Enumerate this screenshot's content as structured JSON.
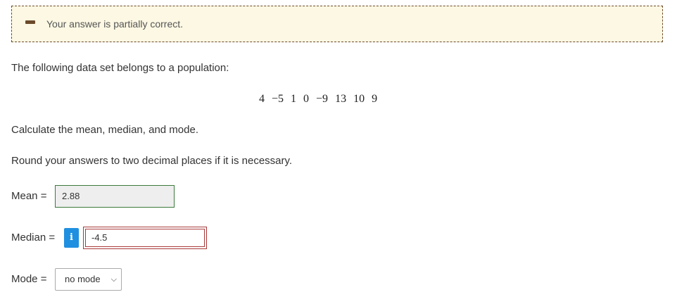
{
  "feedback": {
    "message": "Your answer is partially correct."
  },
  "question": {
    "intro": "The following data set belongs to a population:",
    "dataset": [
      "4",
      "−5",
      "1",
      "0",
      "−9",
      "13",
      "10",
      "9"
    ],
    "instruction": "Calculate the mean, median, and mode.",
    "rounding": "Round your answers to two decimal places if it is necessary."
  },
  "answers": {
    "mean_label": "Mean =",
    "mean_value": "2.88",
    "median_label": "Median =",
    "median_value": "-4.5",
    "info_icon_text": "i",
    "mode_label": "Mode =",
    "mode_value": "no mode"
  },
  "colors": {
    "banner_bg": "#fcf8e3",
    "banner_border": "#6b4a2a",
    "correct_border": "#3c7a3c",
    "incorrect_border": "#a83838",
    "info_button": "#1f8fe0"
  }
}
